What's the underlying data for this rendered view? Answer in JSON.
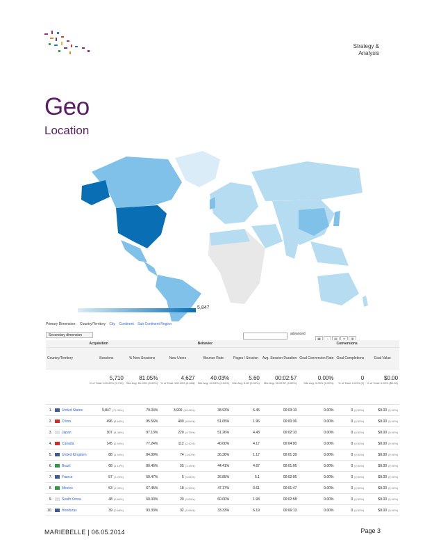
{
  "header": {
    "section_line1": "Strategy &",
    "section_line2": "Analysis"
  },
  "page": {
    "title": "Geo",
    "subtitle": "Location"
  },
  "map": {
    "legend_max": "5,847",
    "colors": {
      "high": "#0a6eb4",
      "mid": "#7fc1e8",
      "low": "#d9ecf7",
      "none": "#e8e8e8"
    }
  },
  "tabs": {
    "primary": "Primary Dimension:",
    "country": "Country/Territory",
    "city": "City",
    "continent": "Continent",
    "subcontinent": "Sub Continent Region"
  },
  "controls": {
    "secondary": "Secondary dimension",
    "advanced": "advanced"
  },
  "table": {
    "groups": {
      "acquisition": "Acquisition",
      "behavior": "Behavior",
      "conversions": "Conversions"
    },
    "dim_header": "Country/Territory",
    "columns": [
      "Sessions",
      "% New Sessions",
      "New Users",
      "Bounce Rate",
      "Pages / Session",
      "Avg. Session Duration",
      "Goal Conversion Rate",
      "Goal Completions",
      "Goal Value"
    ],
    "totals": [
      {
        "value": "5,710",
        "sub": "% of Total: 100.00% (5,710)"
      },
      {
        "value": "81.05%",
        "sub": "Site Avg: 81.05% (0.00%)"
      },
      {
        "value": "4,627",
        "sub": "% of Total: 100.00% (4,628)"
      },
      {
        "value": "40.03%",
        "sub": "Site Avg: 40.03% (0.00%)"
      },
      {
        "value": "5.60",
        "sub": "Site Avg: 5.60 (0.00%)"
      },
      {
        "value": "00:02:57",
        "sub": "Site Avg: 00:02:57 (0.00%)"
      },
      {
        "value": "0.00%",
        "sub": "Site Avg: 0.00% (0.00%)"
      },
      {
        "value": "0",
        "sub": "% of Total: 0.00% (0)"
      },
      {
        "value": "$0.00",
        "sub": "% of Total: 0.00% ($0.00)"
      }
    ],
    "rows": [
      {
        "n": "1.",
        "country": "United States",
        "flag": "#3c5a9a",
        "sessions": "5,847",
        "spct": "(71.35%)",
        "newpct": "79.04%",
        "newusers": "3,900",
        "npct": "(84.28%)",
        "bounce": "38.93%",
        "pages": "6.45",
        "dur": "00:03:10",
        "conv": "0.00%",
        "comp": "0",
        "cpct": "(0.00%)",
        "val": "$0.00",
        "vpct": "(0.00%)"
      },
      {
        "n": "2.",
        "country": "China",
        "flag": "#d82a20",
        "sessions": "496",
        "spct": "(8.69%)",
        "newpct": "95.56%",
        "newusers": "400",
        "npct": "(8.64%)",
        "bounce": "51.65%",
        "pages": "1.96",
        "dur": "00:00:36",
        "conv": "0.00%",
        "comp": "0",
        "cpct": "(0.00%)",
        "val": "$0.00",
        "vpct": "(0.00%)"
      },
      {
        "n": "3.",
        "country": "Japan",
        "flag": "#e0e0e0",
        "sessions": "307",
        "spct": "(5.38%)",
        "newpct": "97.13%",
        "newusers": "220",
        "npct": "(4.75%)",
        "bounce": "51.26%",
        "pages": "4.43",
        "dur": "00:02:10",
        "conv": "0.00%",
        "comp": "0",
        "cpct": "(0.00%)",
        "val": "$0.00",
        "vpct": "(0.00%)"
      },
      {
        "n": "4.",
        "country": "Canada",
        "flag": "#d82a20",
        "sessions": "145",
        "spct": "(2.54%)",
        "newpct": "77.24%",
        "newusers": "112",
        "npct": "(2.42%)",
        "bounce": "40.00%",
        "pages": "4.17",
        "dur": "00:04:00",
        "conv": "0.00%",
        "comp": "0",
        "cpct": "(0.00%)",
        "val": "$0.00",
        "vpct": "(0.00%)"
      },
      {
        "n": "5.",
        "country": "United Kingdom",
        "flag": "#3c5a9a",
        "sessions": "88",
        "spct": "(1.54%)",
        "newpct": "84.09%",
        "newusers": "74",
        "npct": "(1.60%)",
        "bounce": "36.36%",
        "pages": "1.17",
        "dur": "00:01:39",
        "conv": "0.00%",
        "comp": "0",
        "cpct": "(0.00%)",
        "val": "$0.00",
        "vpct": "(0.00%)"
      },
      {
        "n": "6.",
        "country": "Brazil",
        "flag": "#2a9a3a",
        "sessions": "68",
        "spct": "(1.19%)",
        "newpct": "80.46%",
        "newusers": "55",
        "npct": "(1.19%)",
        "bounce": "44.41%",
        "pages": "4.67",
        "dur": "00:01:06",
        "conv": "0.00%",
        "comp": "0",
        "cpct": "(0.00%)",
        "val": "$0.00",
        "vpct": "(0.00%)"
      },
      {
        "n": "7.",
        "country": "France",
        "flag": "#3c5a9a",
        "sessions": "57",
        "spct": "(1.00%)",
        "newpct": "60.47%",
        "newusers": "5",
        "npct": "(0.66%)",
        "bounce": "26.85%",
        "pages": "5.1",
        "dur": "00:02:06",
        "conv": "0.00%",
        "comp": "0",
        "cpct": "(0.00%)",
        "val": "$0.00",
        "vpct": "(0.00%)"
      },
      {
        "n": "8.",
        "country": "Mexico",
        "flag": "#2a9a3a",
        "sessions": "53",
        "spct": "(0.93%)",
        "newpct": "67.45%",
        "newusers": "18",
        "npct": "(0.39%)",
        "bounce": "47.17%",
        "pages": "3.61",
        "dur": "00:01:47",
        "conv": "0.00%",
        "comp": "0",
        "cpct": "(0.00%)",
        "val": "$0.00",
        "vpct": "(0.00%)"
      },
      {
        "n": "9.",
        "country": "South Korea",
        "flag": "#e0e0e0",
        "sessions": "48",
        "spct": "(0.84%)",
        "newpct": "60.00%",
        "newusers": "29",
        "npct": "(0.63%)",
        "bounce": "60.00%",
        "pages": "1.93",
        "dur": "00:02:58",
        "conv": "0.00%",
        "comp": "0",
        "cpct": "(0.00%)",
        "val": "$0.00",
        "vpct": "(0.00%)"
      },
      {
        "n": "10.",
        "country": "Honduras",
        "flag": "#3c5a9a",
        "sessions": "39",
        "spct": "(0.68%)",
        "newpct": "93.33%",
        "newusers": "32",
        "npct": "(0.69%)",
        "bounce": "33.33%",
        "pages": "6.19",
        "dur": "00:06:13",
        "conv": "0.00%",
        "comp": "0",
        "cpct": "(0.00%)",
        "val": "$0.00",
        "vpct": "(0.00%)"
      }
    ]
  },
  "footer": {
    "left": "MARIEBELLE | 06.05.2014",
    "right": "Page 3"
  }
}
